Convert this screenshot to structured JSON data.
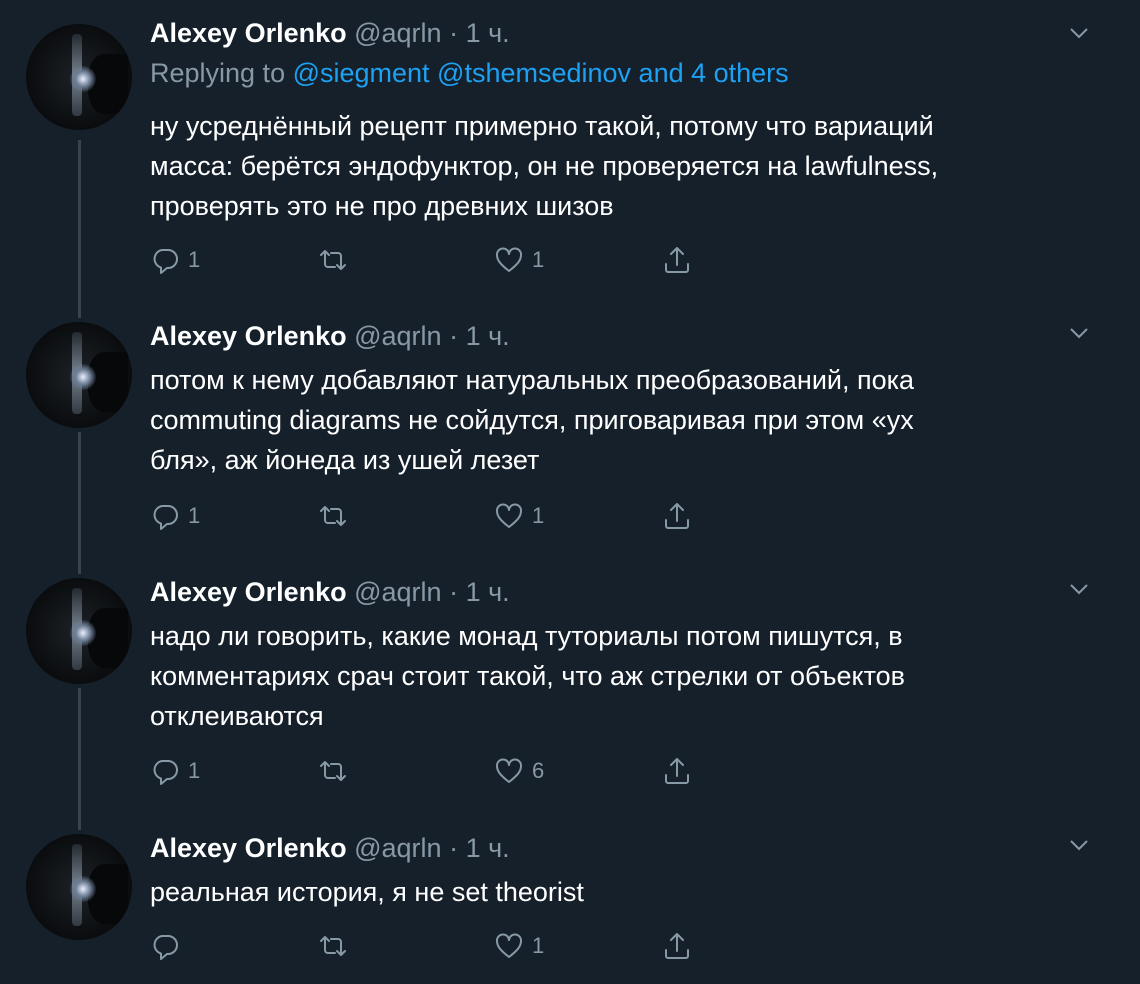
{
  "tweets": [
    {
      "name": "Alexey Orlenko",
      "handle": "@aqrln",
      "dot": "·",
      "time": "1 ч.",
      "reply_prefix": "Replying to ",
      "reply_targets": "@siegment @tshemsedinov and 4 others",
      "text": "ну усреднённый рецепт примерно такой, потому что вариаций\nмасса: берётся эндофунктор, он не проверяется на lawfulness,\nпроверять это не про древних шизов",
      "replies": "1",
      "retweets": "",
      "likes": "1"
    },
    {
      "name": "Alexey Orlenko",
      "handle": "@aqrln",
      "dot": "·",
      "time": "1 ч.",
      "text": "потом к нему добавляют натуральных преобразований, пока\ncommuting diagrams не сойдутся, приговаривая при этом «ух\nбля», аж йонеда из ушей лезет",
      "replies": "1",
      "retweets": "",
      "likes": "1"
    },
    {
      "name": "Alexey Orlenko",
      "handle": "@aqrln",
      "dot": "·",
      "time": "1 ч.",
      "text": "надо ли говорить, какие монад туториалы потом пишутся, в\nкомментариях срач стоит такой, что аж стрелки от объектов\nотклеиваются",
      "replies": "1",
      "retweets": "",
      "likes": "6"
    },
    {
      "name": "Alexey Orlenko",
      "handle": "@aqrln",
      "dot": "·",
      "time": "1 ч.",
      "text": "реальная история, я не set theorist",
      "replies": "",
      "retweets": "",
      "likes": "1"
    }
  ],
  "icons": {
    "reply": "reply-icon",
    "retweet": "retweet-icon",
    "like": "heart-icon",
    "share": "share-icon",
    "menu": "chevron-down-icon"
  },
  "colors": {
    "background": "#15202b",
    "secondary_text": "#8899a6",
    "link": "#1da1f2",
    "thread_line": "#38444d"
  }
}
